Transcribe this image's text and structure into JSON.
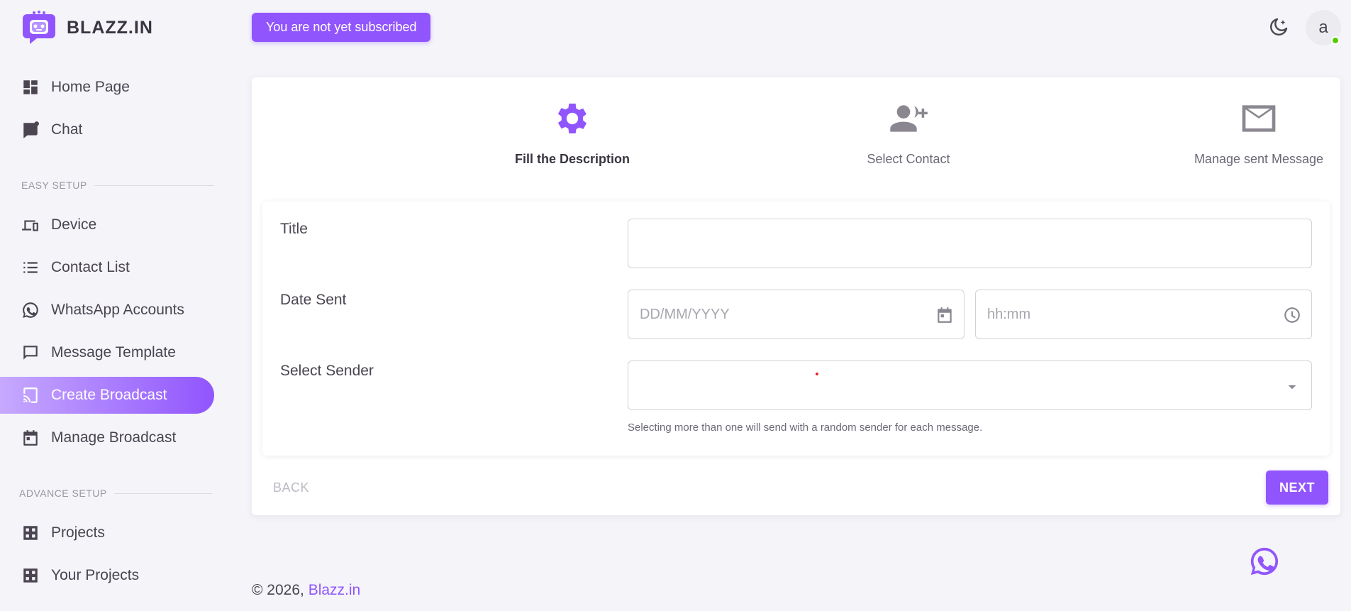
{
  "brand": {
    "name": "BLAZZ.IN"
  },
  "nav": {
    "home": "Home Page",
    "chat": "Chat",
    "easy_setup": "EASY SETUP",
    "device": "Device",
    "contact_list": "Contact List",
    "whatsapp_accounts": "WhatsApp Accounts",
    "message_template": "Message Template",
    "create_broadcast": "Create Broadcast",
    "manage_broadcast": "Manage Broadcast",
    "advance_setup": "ADVANCE SETUP",
    "projects": "Projects",
    "your_projects": "Your Projects"
  },
  "topbar": {
    "subscription_notice": "You are not yet subscribed",
    "avatar_initial": "a"
  },
  "stepper": {
    "steps": [
      {
        "label": "Fill the Description",
        "icon": "gear-icon",
        "active": true
      },
      {
        "label": "Select Contact",
        "icon": "add-user-icon",
        "active": false
      },
      {
        "label": "Manage sent Message",
        "icon": "envelope-icon",
        "active": false
      }
    ]
  },
  "form": {
    "title_label": "Title",
    "title_value": "",
    "date_label": "Date Sent",
    "date_placeholder": "DD/MM/YYYY",
    "time_placeholder": "hh:mm",
    "sender_label": "Select Sender",
    "sender_helper": "Selecting more than one will send with a random sender for each message."
  },
  "actions": {
    "back": "BACK",
    "next": "NEXT"
  },
  "footer": {
    "copyright": "© 2026,",
    "link": "Blazz.in"
  },
  "colors": {
    "accent": "#9155fd",
    "online": "#56ca00",
    "background": "#f4f4f9"
  }
}
